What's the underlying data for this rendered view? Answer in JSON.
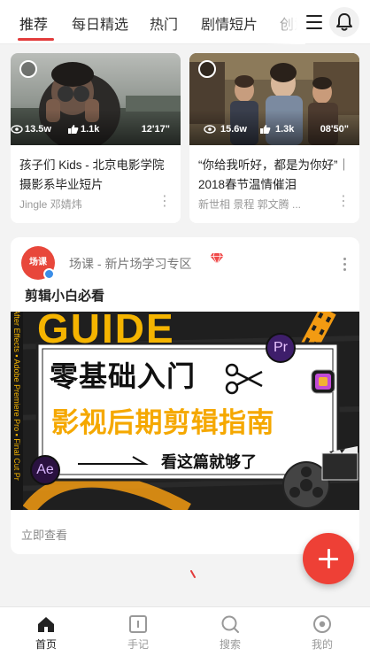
{
  "tabs": [
    "推荐",
    "每日精选",
    "热门",
    "剧情短片",
    "创意"
  ],
  "active_tab": "推荐",
  "videos": [
    {
      "views": "13.5w",
      "likes": "1.1k",
      "duration": "12'17\"",
      "title": "孩子们 Kids - 北京电影学院摄影系毕业短片",
      "author": "Jingle 邓婧炜"
    },
    {
      "views": "15.6w",
      "likes": "1.3k",
      "duration": "08'50\"",
      "title": "“你给我听好，都是为你好”｜2018春节温情催泪",
      "author": "新世相 景程 郭文腾 ..."
    }
  ],
  "course_card": {
    "avatar_text": "场课",
    "channel": "场课 - 新片场学习专区",
    "subtitle": "剪辑小白必看",
    "banner": {
      "bg_word": "GUIDE",
      "headline": "零基础入门",
      "subheadline": "影视后期剪辑指南",
      "tagline": "看这篇就够了",
      "side_text": "After Effects ▪ Adobe Premiere Pro ▪ Final Cut Pr",
      "badge_pr": "Pr",
      "badge_ae": "Ae"
    },
    "footer": "立即查看"
  },
  "bottom_nav": [
    {
      "label": "首页",
      "icon": "home-icon",
      "active": true
    },
    {
      "label": "手记",
      "icon": "notebook-icon",
      "active": false
    },
    {
      "label": "搜索",
      "icon": "search-icon",
      "active": false
    },
    {
      "label": "我的",
      "icon": "profile-icon",
      "active": false
    }
  ],
  "colors": {
    "accent": "#e23b3b",
    "fab": "#ee4036",
    "banner_yellow": "#f5b400",
    "banner_orange": "#f39b12"
  }
}
